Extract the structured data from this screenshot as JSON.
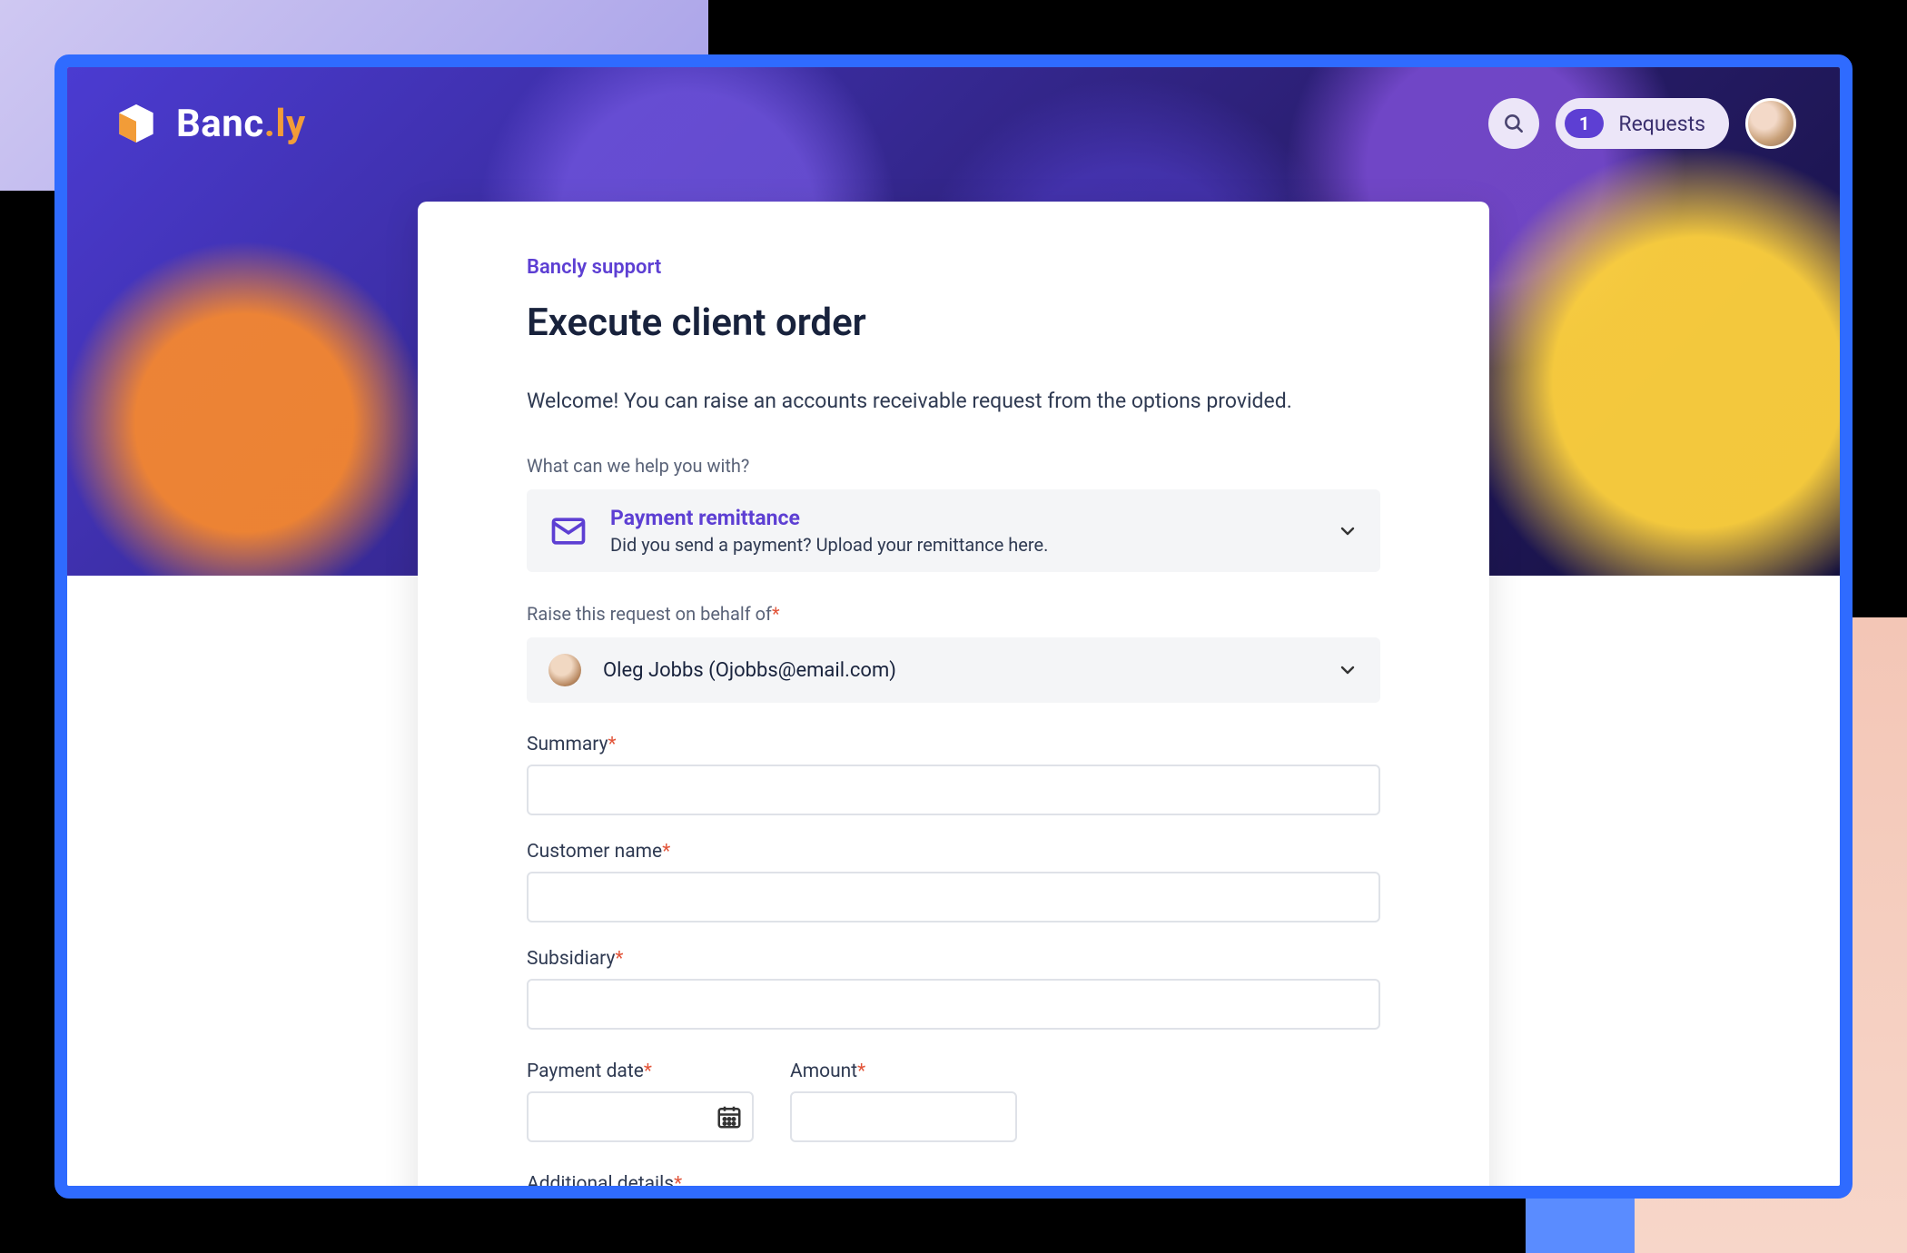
{
  "brand": {
    "name_part1": "Banc",
    "name_part2": ".ly"
  },
  "header": {
    "requests_badge": "1",
    "requests_label": "Requests"
  },
  "breadcrumb": "Bancly support",
  "page_title": "Execute client order",
  "intro_text": "Welcome! You can raise an accounts receivable request from the options provided.",
  "help_section_label": "What can we help you with?",
  "request_type": {
    "title": "Payment remittance",
    "subtitle": "Did you send a payment? Upload your remittance here."
  },
  "on_behalf_label": "Raise this request on behalf of",
  "on_behalf_value": "Oleg Jobbs (Ojobbs@email.com)",
  "fields": {
    "summary": {
      "label": "Summary",
      "value": ""
    },
    "customer_name": {
      "label": "Customer name",
      "value": ""
    },
    "subsidiary": {
      "label": "Subsidiary",
      "value": ""
    },
    "payment_date": {
      "label": "Payment date",
      "value": ""
    },
    "amount": {
      "label": "Amount",
      "value": ""
    },
    "additional_details": {
      "label": "Additional details",
      "value": ""
    }
  },
  "required_marker": "*",
  "colors": {
    "accent": "#5d3fd3",
    "required": "#e2553a",
    "frame": "#2f6bff"
  }
}
